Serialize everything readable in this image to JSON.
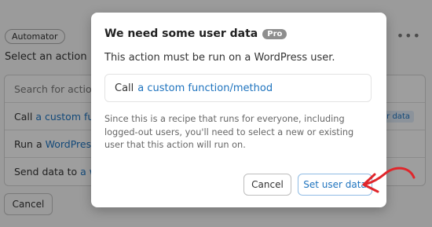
{
  "background": {
    "badge": "Automator",
    "more_icon": "more-dots-icon",
    "section_title": "Select an action",
    "search_placeholder": "Search for actions",
    "rows": [
      {
        "prefix": "Call",
        "link": "a custom func",
        "tag": "r data"
      },
      {
        "prefix": "Run a",
        "link": "WordPress",
        "tag": ""
      },
      {
        "prefix": "Send data to",
        "link": "a we",
        "tag": ""
      }
    ],
    "cancel_label": "Cancel"
  },
  "modal": {
    "title": "We need some user data",
    "pro_badge": "Pro",
    "description": "This action must be run on a WordPress user.",
    "action_prefix": "Call",
    "action_link": "a custom function/method",
    "note": "Since this is a recipe that runs for everyone, including logged-out users, you'll need to select a new or existing user that this action will run on.",
    "cancel_label": "Cancel",
    "confirm_label": "Set user data"
  },
  "annotation": {
    "arrow_color": "#e0262b"
  },
  "colors": {
    "link": "#1e73be",
    "overlay": "rgba(0,0,0,0.36)"
  }
}
